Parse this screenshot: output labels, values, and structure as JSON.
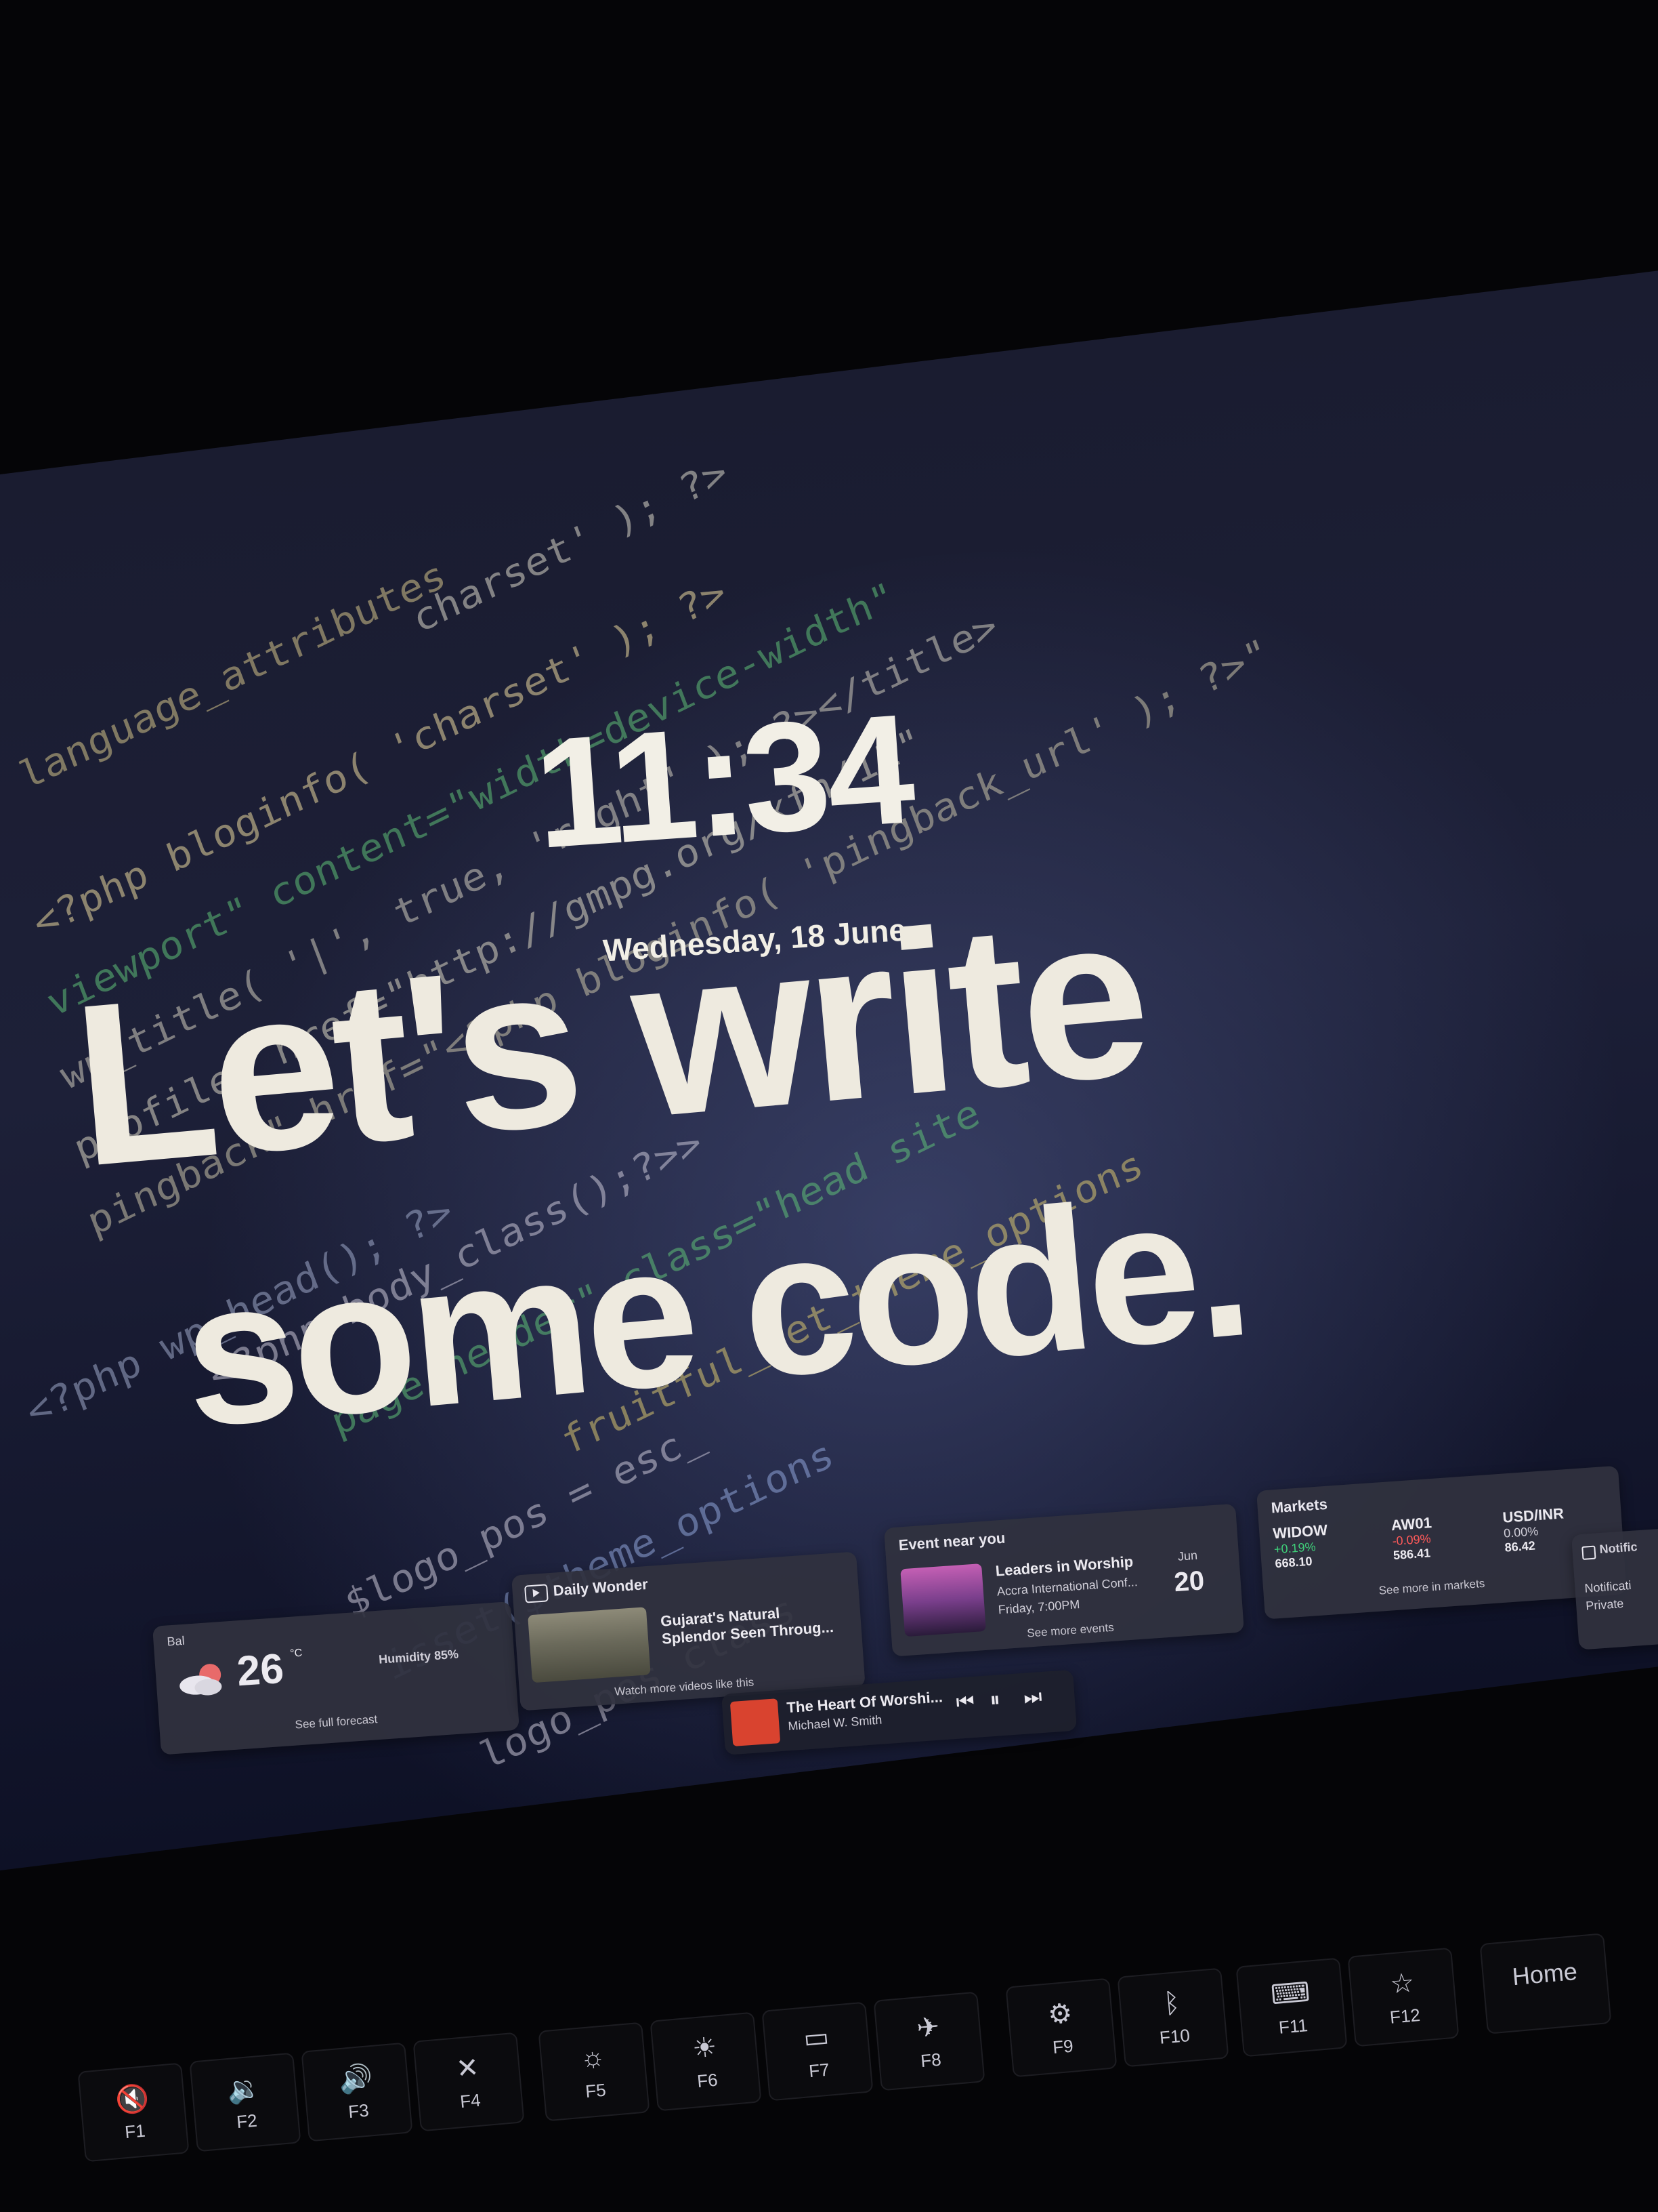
{
  "lockscreen": {
    "time": "11:34",
    "date": "Wednesday, 18 June"
  },
  "wallpaper": {
    "line1": "Let's write",
    "line2": "some code.",
    "code_snippets": [
      "language_attributes",
      "charset' ); ?>",
      "<?php bloginfo( 'charset' ); ?>",
      "viewport\" content=\"width=device-width\"",
      "wp_title( '|', true, 'right' ); ?></title>",
      "profile\" href=\"http://gmpg.org/xfn/11\"",
      "pingback\" href=\"<?php bloginfo( 'pingback_url' ); ?>\"",
      "<?php wp_head(); ?>",
      "<?php body_class();?>>",
      "page-header\" class=\"head site",
      "fruitful_get_theme_options",
      "$logo_pos = esc_",
      "isset($theme_options",
      "logo_pos_class"
    ]
  },
  "widgets": {
    "weather": {
      "location": "Bal",
      "temperature": "26",
      "unit": "°C",
      "humidity": "Humidity 85%",
      "footer": "See full forecast"
    },
    "daily_wonder": {
      "title": "Daily Wonder",
      "headline_line1": "Gujarat's Natural",
      "headline_line2": "Splendor Seen Throug...",
      "footer": "Watch more videos like this"
    },
    "event": {
      "title": "Event near you",
      "name": "Leaders in Worship",
      "venue": "Accra International Conf...",
      "time": "Friday, 7:00PM",
      "month": "Jun",
      "day": "20",
      "footer": "See more events"
    },
    "markets": {
      "title": "Markets",
      "tickers": [
        {
          "symbol": "WIDOW",
          "change": "+0.19%",
          "price": "668.10",
          "trend": "up"
        },
        {
          "symbol": "AW01",
          "change": "-0.09%",
          "price": "586.41",
          "trend": "down"
        },
        {
          "symbol": "USD/INR",
          "change": "0.00%",
          "price": "86.42",
          "trend": "flat"
        }
      ],
      "footer": "See more in markets"
    },
    "notifications": {
      "title": "Notific",
      "line1": "Notificati",
      "line2": "Private"
    },
    "media": {
      "track": "The Heart Of Worshi...",
      "artist": "Michael W. Smith"
    }
  },
  "keyboard": {
    "keys": [
      {
        "label": "F1",
        "icon": "mute-icon",
        "glyph": "🔇"
      },
      {
        "label": "F2",
        "icon": "volume-down-icon",
        "glyph": "🔉"
      },
      {
        "label": "F3",
        "icon": "volume-up-icon",
        "glyph": "🔊"
      },
      {
        "label": "F4",
        "icon": "mic-off-icon",
        "glyph": "✕"
      },
      {
        "label": "F5",
        "icon": "brightness-down-icon",
        "glyph": "☼"
      },
      {
        "label": "F6",
        "icon": "brightness-up-icon",
        "glyph": "☀"
      },
      {
        "label": "F7",
        "icon": "display-icon",
        "glyph": "▭"
      },
      {
        "label": "F8",
        "icon": "airplane-icon",
        "glyph": "✈"
      },
      {
        "label": "F9",
        "icon": "settings-icon",
        "glyph": "⚙"
      },
      {
        "label": "F10",
        "icon": "bluetooth-icon",
        "glyph": "ᛒ"
      },
      {
        "label": "F11",
        "icon": "keyboard-icon",
        "glyph": "⌨"
      },
      {
        "label": "F12",
        "icon": "star-icon",
        "glyph": "☆"
      },
      {
        "label": "Home",
        "icon": "",
        "glyph": ""
      }
    ]
  },
  "colors": {
    "positive": "#3fd07a",
    "negative": "#ff5a5a",
    "widget_bg": "#30323e"
  }
}
